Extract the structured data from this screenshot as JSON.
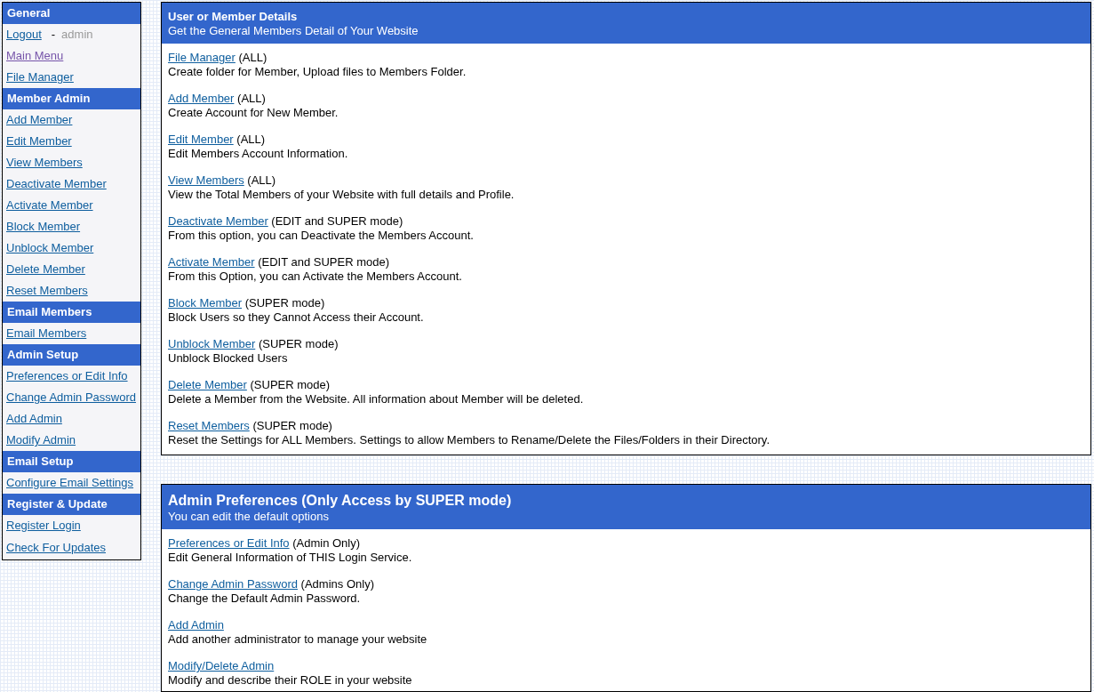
{
  "sidebar": {
    "sections": [
      {
        "heading": "General",
        "items": [
          {
            "label": "Logout",
            "visited": false,
            "separator": "-",
            "user": "admin"
          },
          {
            "label": "Main Menu",
            "visited": true
          },
          {
            "label": "File Manager",
            "visited": false
          }
        ]
      },
      {
        "heading": "Member Admin",
        "items": [
          {
            "label": "Add Member",
            "visited": false
          },
          {
            "label": "Edit Member",
            "visited": false
          },
          {
            "label": "View Members",
            "visited": false
          },
          {
            "label": "Deactivate Member",
            "visited": false
          },
          {
            "label": "Activate Member",
            "visited": false
          },
          {
            "label": "Block Member",
            "visited": false
          },
          {
            "label": "Unblock Member",
            "visited": false
          },
          {
            "label": "Delete Member",
            "visited": false
          },
          {
            "label": "Reset Members",
            "visited": false
          }
        ]
      },
      {
        "heading": "Email Members",
        "items": [
          {
            "label": "Email Members",
            "visited": false
          }
        ]
      },
      {
        "heading": "Admin Setup",
        "items": [
          {
            "label": "Preferences or Edit Info",
            "visited": false
          },
          {
            "label": "Change Admin Password",
            "visited": false
          },
          {
            "label": "Add Admin",
            "visited": false
          },
          {
            "label": "Modify Admin",
            "visited": false
          }
        ]
      },
      {
        "heading": "Email Setup",
        "items": [
          {
            "label": "Configure Email Settings",
            "visited": false
          }
        ]
      },
      {
        "heading": "Register & Update",
        "items": [
          {
            "label": "Register Login",
            "visited": false
          },
          {
            "label": "Check For Updates",
            "visited": false
          }
        ]
      }
    ]
  },
  "panels": [
    {
      "title": "User or Member Details",
      "subtitle": "Get the General Members Detail of Your Website",
      "entries": [
        {
          "link": "File Manager",
          "mode": "(ALL)",
          "description": "Create folder for Member, Upload files to Members Folder."
        },
        {
          "link": "Add Member",
          "mode": "(ALL)",
          "description": "Create Account for New Member."
        },
        {
          "link": "Edit Member",
          "mode": "(ALL)",
          "description": "Edit Members Account Information."
        },
        {
          "link": "View Members",
          "mode": "(ALL)",
          "description": "View the Total Members of your Website with full details and Profile."
        },
        {
          "link": "Deactivate Member",
          "mode": "(EDIT and SUPER mode)",
          "description": "From this option, you can Deactivate the Members Account."
        },
        {
          "link": "Activate Member",
          "mode": "(EDIT and SUPER mode)",
          "description": "From this Option, you can Activate the Members Account."
        },
        {
          "link": "Block Member",
          "mode": "(SUPER mode)",
          "description": "Block Users so they Cannot Access their Account."
        },
        {
          "link": "Unblock Member",
          "mode": "(SUPER mode)",
          "description": "Unblock Blocked Users"
        },
        {
          "link": "Delete Member",
          "mode": "(SUPER mode)",
          "description": "Delete a Member from the Website. All information about Member will be deleted."
        },
        {
          "link": "Reset Members",
          "mode": "(SUPER mode)",
          "description": "Reset the Settings for ALL Members. Settings to allow Members to Rename/Delete the Files/Folders in their Directory."
        }
      ]
    },
    {
      "title": "Admin Preferences (Only Access by SUPER mode)",
      "subtitle": "You can edit the default options",
      "entries": [
        {
          "link": "Preferences or Edit Info",
          "mode": "(Admin Only)",
          "description": "Edit General Information of THIS Login Service."
        },
        {
          "link": "Change Admin Password",
          "mode": "(Admins Only)",
          "description": "Change the Default Admin Password."
        },
        {
          "link": "Add Admin",
          "description": "Add another administrator to manage your website"
        },
        {
          "link": "Modify/Delete Admin",
          "description": "Modify and describe their ROLE in your website"
        }
      ]
    }
  ]
}
